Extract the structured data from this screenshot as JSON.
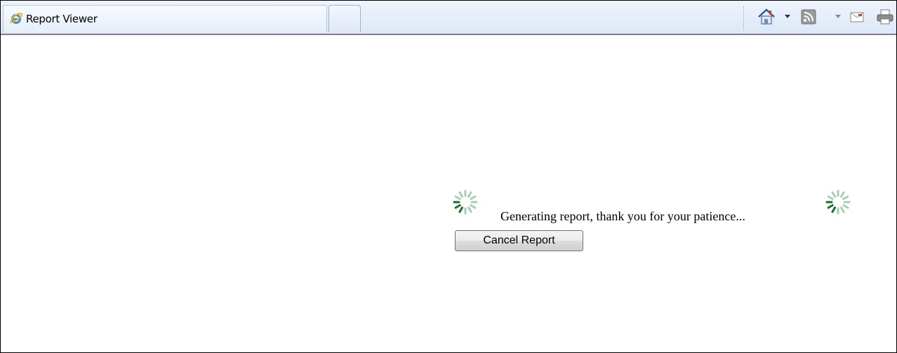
{
  "window": {
    "tab_title": "Report Viewer",
    "icons": {
      "tab_icon": "ie-icon",
      "home": "home-icon",
      "feeds": "rss-feed-icon",
      "mail": "mail-icon",
      "print": "print-icon"
    }
  },
  "report": {
    "loading_message": "Generating report, thank you for your patience...",
    "cancel_label": "Cancel Report",
    "spinner_icon": "loading-spinner-icon",
    "colors": {
      "spinner_dark": "#1f6b2a",
      "spinner_light": "#a9cdb0"
    }
  }
}
